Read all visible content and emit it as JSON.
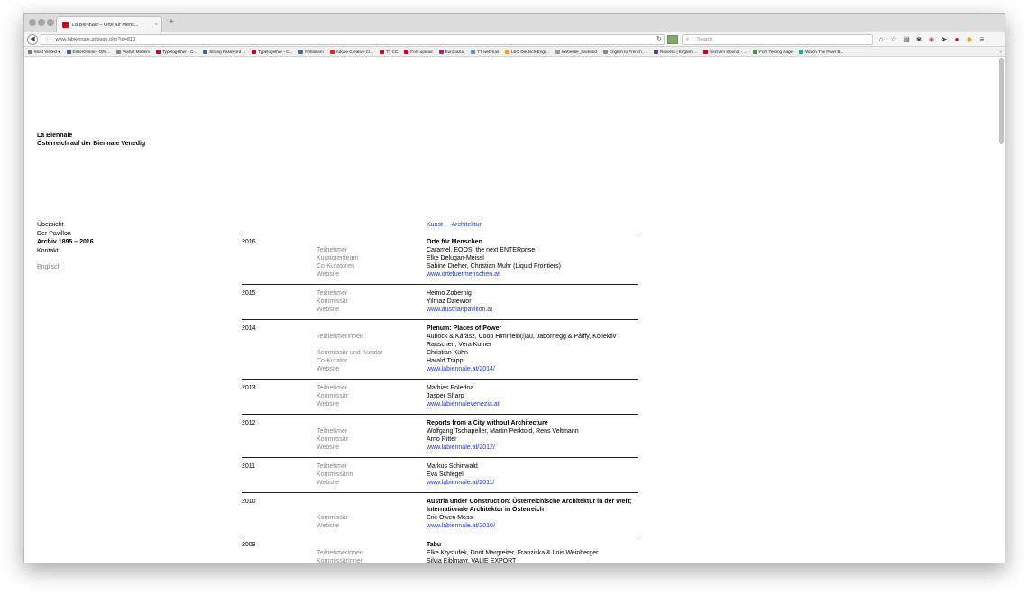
{
  "browser": {
    "tab_title": "La Biennale – Orte für Mens...",
    "tab_close": "×",
    "new_tab": "+",
    "url": "www.labiennale.at/page.php?id=810",
    "search_placeholder": "Search",
    "bookmarks": [
      {
        "label": "Most Visited ▾",
        "color": "#6b7aa8"
      },
      {
        "label": "ElsterOnline - Öffe...",
        "color": "#3c5fa0"
      },
      {
        "label": "ViaSat Modem",
        "color": "#888888"
      },
      {
        "label": "Typetogether - C...",
        "color": "#d0021b"
      },
      {
        "label": "Strong Password ...",
        "color": "#2a6db0"
      },
      {
        "label": "Typetogether - C...",
        "color": "#d0021b"
      },
      {
        "label": "Přihlášení",
        "color": "#3a6fb0"
      },
      {
        "label": "Adobe Creative Cl...",
        "color": "#e3261d"
      },
      {
        "label": "TT CC",
        "color": "#d0021b"
      },
      {
        "label": "Font upload",
        "color": "#d0021b"
      },
      {
        "label": "EuropaSat",
        "color": "#b01c8c"
      },
      {
        "label": "TT webmail",
        "color": "#5f8fc8"
      },
      {
        "label": "LEO Deutsch-Engl...",
        "color": "#e7a12e"
      },
      {
        "label": "fonttester_backend",
        "color": "#999999"
      },
      {
        "label": "English to French, ...",
        "color": "#888888"
      },
      {
        "label": "Reverso | English ...",
        "color": "#6a2fb0"
      },
      {
        "label": "Seznam Slovník - ...",
        "color": "#d0021b"
      },
      {
        "label": "Font Testing Page",
        "color": "#3d9a3d"
      },
      {
        "label": "Watch The Pearl B...",
        "color": "#2aa59a"
      }
    ],
    "bookmarks_more": "»"
  },
  "site": {
    "title_line1": "La Biennale",
    "title_line2": "Österreich auf der Biennale Venedig"
  },
  "nav": {
    "items": [
      {
        "label": "Übersicht"
      },
      {
        "label": "Der Pavillon"
      },
      {
        "label": "Archiv 1895 – 2016"
      },
      {
        "label": "Kontakt"
      }
    ],
    "language": "Englisch"
  },
  "filters": [
    "Kunst",
    "Architektur"
  ],
  "archive": [
    {
      "year": "2016",
      "title": "Orte für Menschen",
      "rows": [
        {
          "role": "Teilnehmer",
          "value": "Caramel, EOOS, the next ENTERprise"
        },
        {
          "role": "Kuratorenteam",
          "value": "Elke Delugan-Meissl"
        },
        {
          "role": "Co-Kuratoren",
          "value": "Sabine Dreher, Christian Muhr (Liquid Frontiers)"
        },
        {
          "role": "Website",
          "value": "www.ortefuermenschen.at",
          "link": true
        }
      ]
    },
    {
      "year": "2015",
      "title": "",
      "rows": [
        {
          "role": "Teilnehmer",
          "value": "Heimo Zobernig"
        },
        {
          "role": "Kommissär",
          "value": "Yilmaz Dziewior"
        },
        {
          "role": "Website",
          "value": "www.austrianpavilion.at",
          "link": true
        }
      ]
    },
    {
      "year": "2014",
      "title": "Plenum: Places of Power",
      "rows": [
        {
          "role": "TeilnehmerInnen",
          "value": "Auböck & Kárász, Coop Himmelb(l)au, Jabornegg & Pálffy, Kollektiv Rauschen, Vera Kumer"
        },
        {
          "role": "Kommissär und Kurator",
          "value": "Christian Kühn"
        },
        {
          "role": "Co-Kurator",
          "value": "Harald Trapp"
        },
        {
          "role": "Website",
          "value": "www.labiennale.at/2014/",
          "link": true
        }
      ]
    },
    {
      "year": "2013",
      "title": "",
      "rows": [
        {
          "role": "Teilnehmer",
          "value": "Mathias Poledna"
        },
        {
          "role": "Kommissär",
          "value": "Jasper Sharp"
        },
        {
          "role": "Website",
          "value": "www.labiennalevenezia.at",
          "link": true
        }
      ]
    },
    {
      "year": "2012",
      "title": "Reports from a City without Architecture",
      "rows": [
        {
          "role": "Teilnehmer",
          "value": "Wolfgang Tschapeller, Martin Perktold, Rens Veltmann"
        },
        {
          "role": "Kommissär",
          "value": "Arno Ritter"
        },
        {
          "role": "Website",
          "value": "www.labiennale.at/2012/",
          "link": true
        }
      ]
    },
    {
      "year": "2011",
      "title": "",
      "rows": [
        {
          "role": "Teilnehmer",
          "value": "Markus Schinwald"
        },
        {
          "role": "Kommissärin",
          "value": "Eva Schlegel"
        },
        {
          "role": "Website",
          "value": "www.labiennale.at/2011/",
          "link": true
        }
      ]
    },
    {
      "year": "2010",
      "title": "Austria under Construction: Österreichische Architektur in der Welt; Internationale Architektur in Österreich",
      "rows": [
        {
          "role": "Kommissär",
          "value": "Eric Owen Moss"
        },
        {
          "role": "Website",
          "value": "www.labiennale.at/2010/",
          "link": true
        }
      ]
    },
    {
      "year": "2009",
      "title": "Tabu",
      "rows": [
        {
          "role": "TeilnehmerInnen",
          "value": "Elke Krystufek, Dorit Margreiter, Franziska & Lois Weinberger"
        },
        {
          "role": "KommissärInnen",
          "value": "Silvia Eiblmayr, VALIE EXPORT"
        }
      ]
    }
  ]
}
